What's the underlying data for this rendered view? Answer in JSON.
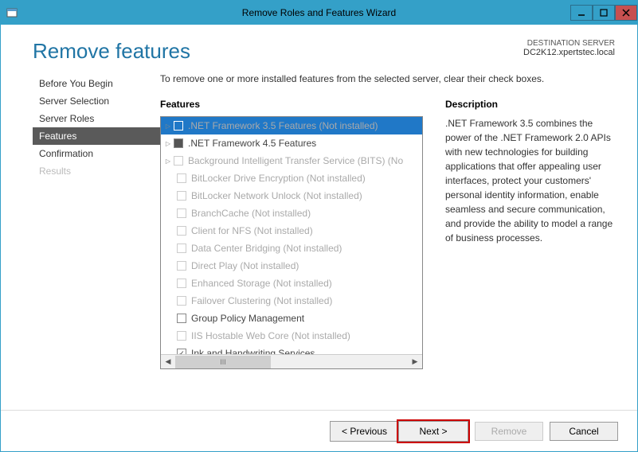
{
  "window": {
    "title": "Remove Roles and Features Wizard"
  },
  "page_title": "Remove features",
  "destination": {
    "label": "DESTINATION SERVER",
    "server": "DC2K12.xpertstec.local"
  },
  "instruction": "To remove one or more installed features from the selected server, clear their check boxes.",
  "sidebar": {
    "items": [
      {
        "label": "Before You Begin"
      },
      {
        "label": "Server Selection"
      },
      {
        "label": "Server Roles"
      },
      {
        "label": "Features",
        "selected": true
      },
      {
        "label": "Confirmation"
      },
      {
        "label": "Results",
        "disabled": true
      }
    ]
  },
  "columns": {
    "features": "Features",
    "description": "Description"
  },
  "features_list": [
    {
      "label": ".NET Framework 3.5 Features (Not installed)",
      "expandable": true,
      "selected": true,
      "disabled": true
    },
    {
      "label": ".NET Framework 4.5 Features",
      "expandable": true,
      "filled": true
    },
    {
      "label": "Background Intelligent Transfer Service (BITS) (No",
      "expandable": true,
      "disabled": true
    },
    {
      "label": "BitLocker Drive Encryption (Not installed)",
      "disabled": true
    },
    {
      "label": "BitLocker Network Unlock (Not installed)",
      "disabled": true
    },
    {
      "label": "BranchCache (Not installed)",
      "disabled": true
    },
    {
      "label": "Client for NFS (Not installed)",
      "disabled": true
    },
    {
      "label": "Data Center Bridging (Not installed)",
      "disabled": true
    },
    {
      "label": "Direct Play (Not installed)",
      "disabled": true
    },
    {
      "label": "Enhanced Storage (Not installed)",
      "disabled": true
    },
    {
      "label": "Failover Clustering (Not installed)",
      "disabled": true
    },
    {
      "label": "Group Policy Management"
    },
    {
      "label": "IIS Hostable Web Core (Not installed)",
      "disabled": true
    },
    {
      "label": "Ink and Handwriting Services",
      "checked": true
    }
  ],
  "description_text": ".NET Framework 3.5 combines the power of the .NET Framework 2.0 APIs with new technologies for building applications that offer appealing user interfaces, protect your customers' personal identity information, enable seamless and secure communication, and provide the ability to model a range of business processes.",
  "buttons": {
    "previous": "< Previous",
    "next": "Next >",
    "remove": "Remove",
    "cancel": "Cancel"
  }
}
